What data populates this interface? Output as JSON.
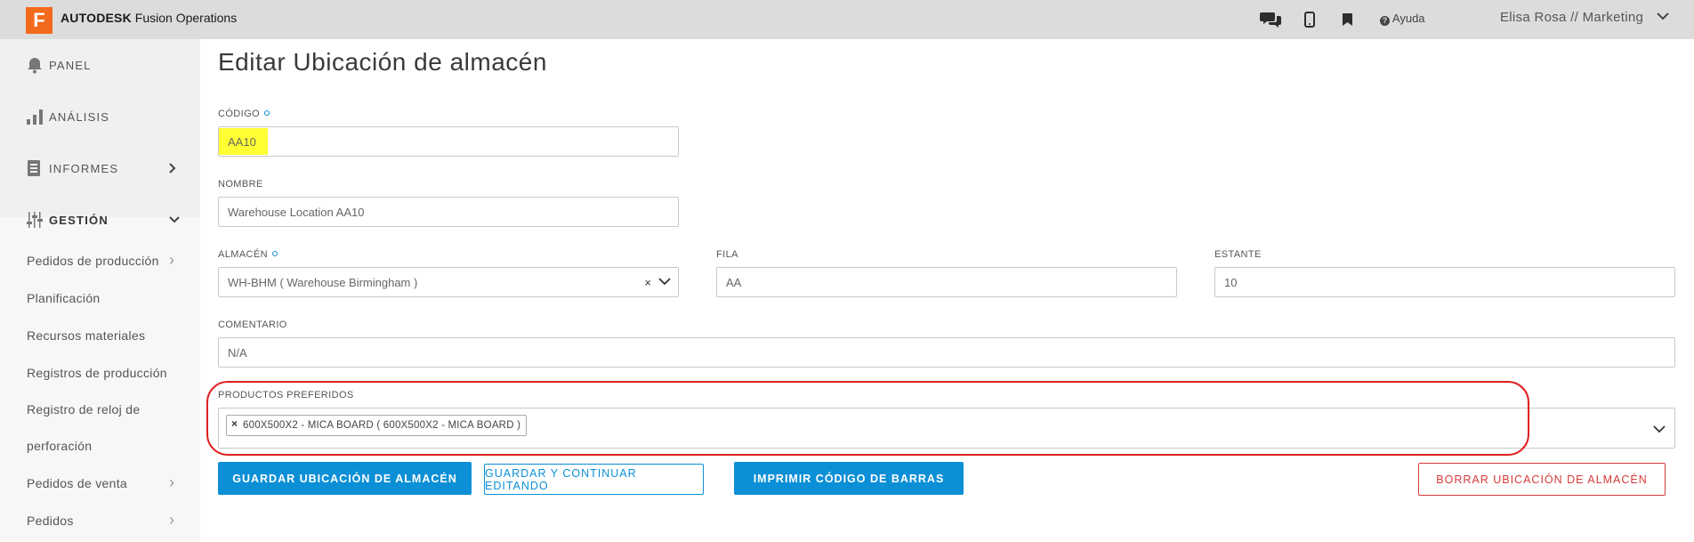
{
  "header": {
    "logo_letter": "F",
    "brand_bold": "AUTODESK",
    "brand_rest": " Fusion Operations",
    "help_label": "Ayuda",
    "user_label": "Elisa Rosa // Marketing",
    "icons": [
      "chat-icon",
      "mobile-icon",
      "bookmark-icon",
      "help-icon",
      "chevron-down-icon"
    ]
  },
  "sidebar": {
    "panel": "PANEL",
    "analisis": "ANÁLISIS",
    "informes": "INFORMES",
    "gestion": "GESTIÓN",
    "sub_items": [
      {
        "label": "Pedidos de producción",
        "has_chevron": true
      },
      {
        "label": "Planificación",
        "has_chevron": false
      },
      {
        "label": "Recursos materiales",
        "has_chevron": false
      },
      {
        "label": "Registros de producción",
        "has_chevron": false
      },
      {
        "label": "Registro de reloj de",
        "has_chevron": false
      },
      {
        "label": "perforación",
        "has_chevron": false
      },
      {
        "label": "Pedidos de venta",
        "has_chevron": true
      },
      {
        "label": "Pedidos",
        "has_chevron": true
      }
    ]
  },
  "form": {
    "title": "Editar Ubicación de almacén",
    "codigo": {
      "label": "CÓDIGO",
      "value": "AA10"
    },
    "nombre": {
      "label": "NOMBRE",
      "value": "Warehouse Location AA10"
    },
    "almacen": {
      "label": "ALMACÉN",
      "value": "WH-BHM ( Warehouse Birmingham )",
      "clear": "×"
    },
    "fila": {
      "label": "FILA",
      "value": "AA"
    },
    "estante": {
      "label": "ESTANTE",
      "value": "10"
    },
    "comentario": {
      "label": "COMENTARIO",
      "value": "N/A"
    },
    "productos": {
      "label": "PRODUCTOS PREFERIDOS",
      "tag": "600X500X2 - MICA BOARD ( 600X500X2 - MICA BOARD )",
      "tag_remove": "×"
    }
  },
  "buttons": {
    "save": "GUARDAR UBICACIÓN DE ALMACÉN",
    "save_continue": "GUARDAR Y CONTINUAR EDITANDO",
    "print_barcode": "IMPRIMIR CÓDIGO DE BARRAS",
    "delete": "BORRAR UBICACIÓN DE ALMACÉN"
  },
  "colors": {
    "brand_orange": "#f26a1b",
    "primary_blue": "#0b8fd6",
    "danger_red": "#d63a3a",
    "highlight_yellow": "#ffff33",
    "annotation_red": "#e02020"
  }
}
